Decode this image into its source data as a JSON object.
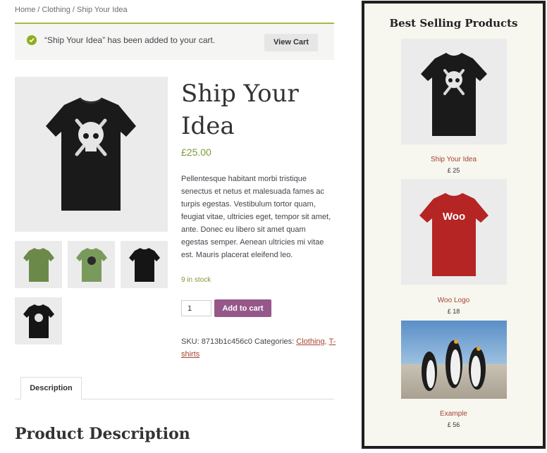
{
  "breadcrumb": {
    "home": "Home",
    "sep": " / ",
    "category": "Clothing",
    "current": "Ship Your Idea"
  },
  "notice": {
    "message": "“Ship Your Idea” has been added to your cart.",
    "button": "View Cart"
  },
  "product": {
    "title": "Ship Your Idea",
    "price": "£25.00",
    "description": "Pellentesque habitant morbi tristique senectus et netus et malesuada fames ac turpis egestas. Vestibulum tortor quam, feugiat vitae, ultricies eget, tempor sit amet, ante. Donec eu libero sit amet quam egestas semper. Aenean ultricies mi vitae est. Mauris placerat eleifend leo.",
    "stock": "9 in stock",
    "quantity": "1",
    "add_to_cart": "Add to cart",
    "sku_label": "SKU: ",
    "sku": "8713b1c456c0",
    "categories_label": " Categories: ",
    "categories": [
      "Clothing",
      "T-shirts"
    ]
  },
  "tabs": [
    {
      "label": "Description"
    }
  ],
  "section_title": "Product Description",
  "sidebar": {
    "title": "Best Selling Products",
    "products": [
      {
        "name": "Ship Your Idea",
        "price": "£ 25"
      },
      {
        "name": "Woo Logo",
        "price": "£ 18"
      },
      {
        "name": "Example",
        "price": "£ 56"
      }
    ]
  },
  "image_text": {
    "woo_logo": "Woo"
  },
  "colors": {
    "accent_green": "#7f9b35",
    "button_purple": "#96588a",
    "link_red": "#a54432",
    "sidebar_bg": "#f7f6ef"
  }
}
